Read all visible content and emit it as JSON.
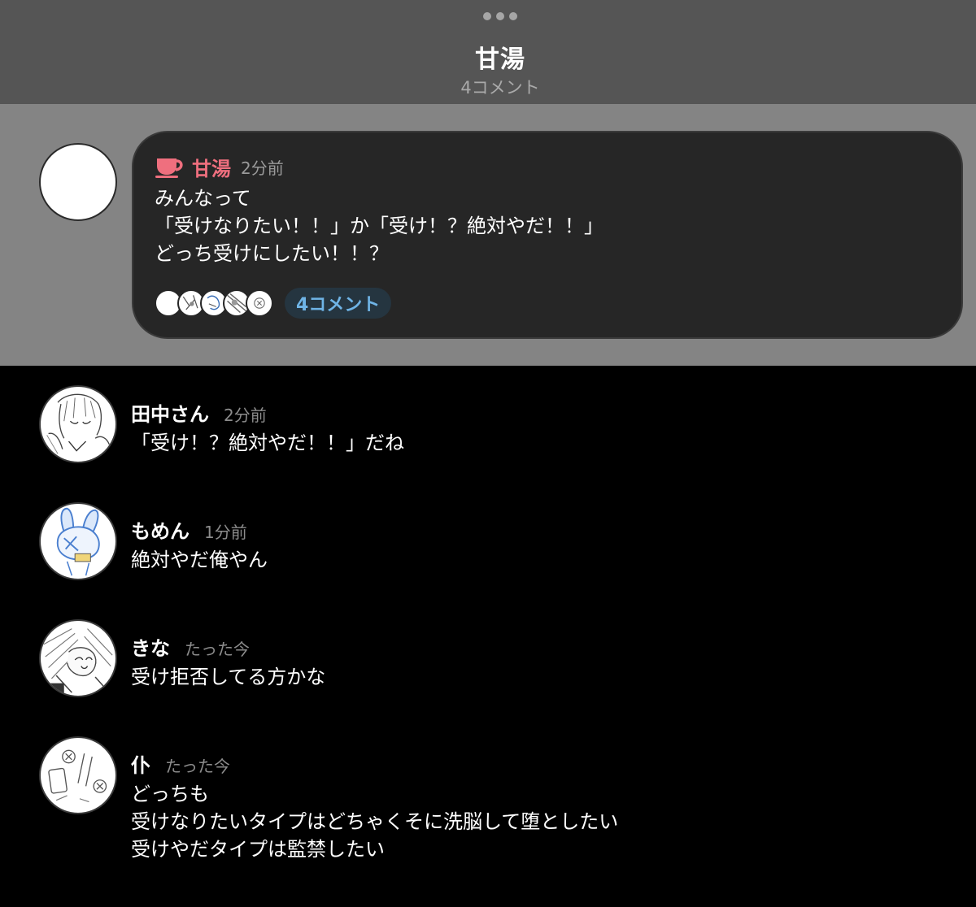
{
  "header": {
    "title": "甘湯",
    "subtitle": "4コメント",
    "more_icon": "more-dots-icon"
  },
  "post": {
    "author": "甘湯",
    "time": "2分前",
    "author_icon": "teacup-icon",
    "author_color": "#ef6f7e",
    "text": "みんなって\n「受けなりたい！！」か「受け！？絶対やだ！！」\nどっち受けにしたい！！？",
    "comment_count_label": "4コメント",
    "accent_color": "#6fb4e6"
  },
  "comments": [
    {
      "name": "田中さん",
      "time": "2分前",
      "text": "「受け！？絶対やだ！！」だね"
    },
    {
      "name": "もめん",
      "time": "1分前",
      "text": "絶対やだ俺やん"
    },
    {
      "name": "きな",
      "time": "たった今",
      "text": "受け拒否してる方かな"
    },
    {
      "name": "仆",
      "time": "たった今",
      "text": "どっちも\n受けなりたいタイプはどちゃくそに洗脳して堕としたい\n受けやだタイプは監禁したい"
    }
  ]
}
